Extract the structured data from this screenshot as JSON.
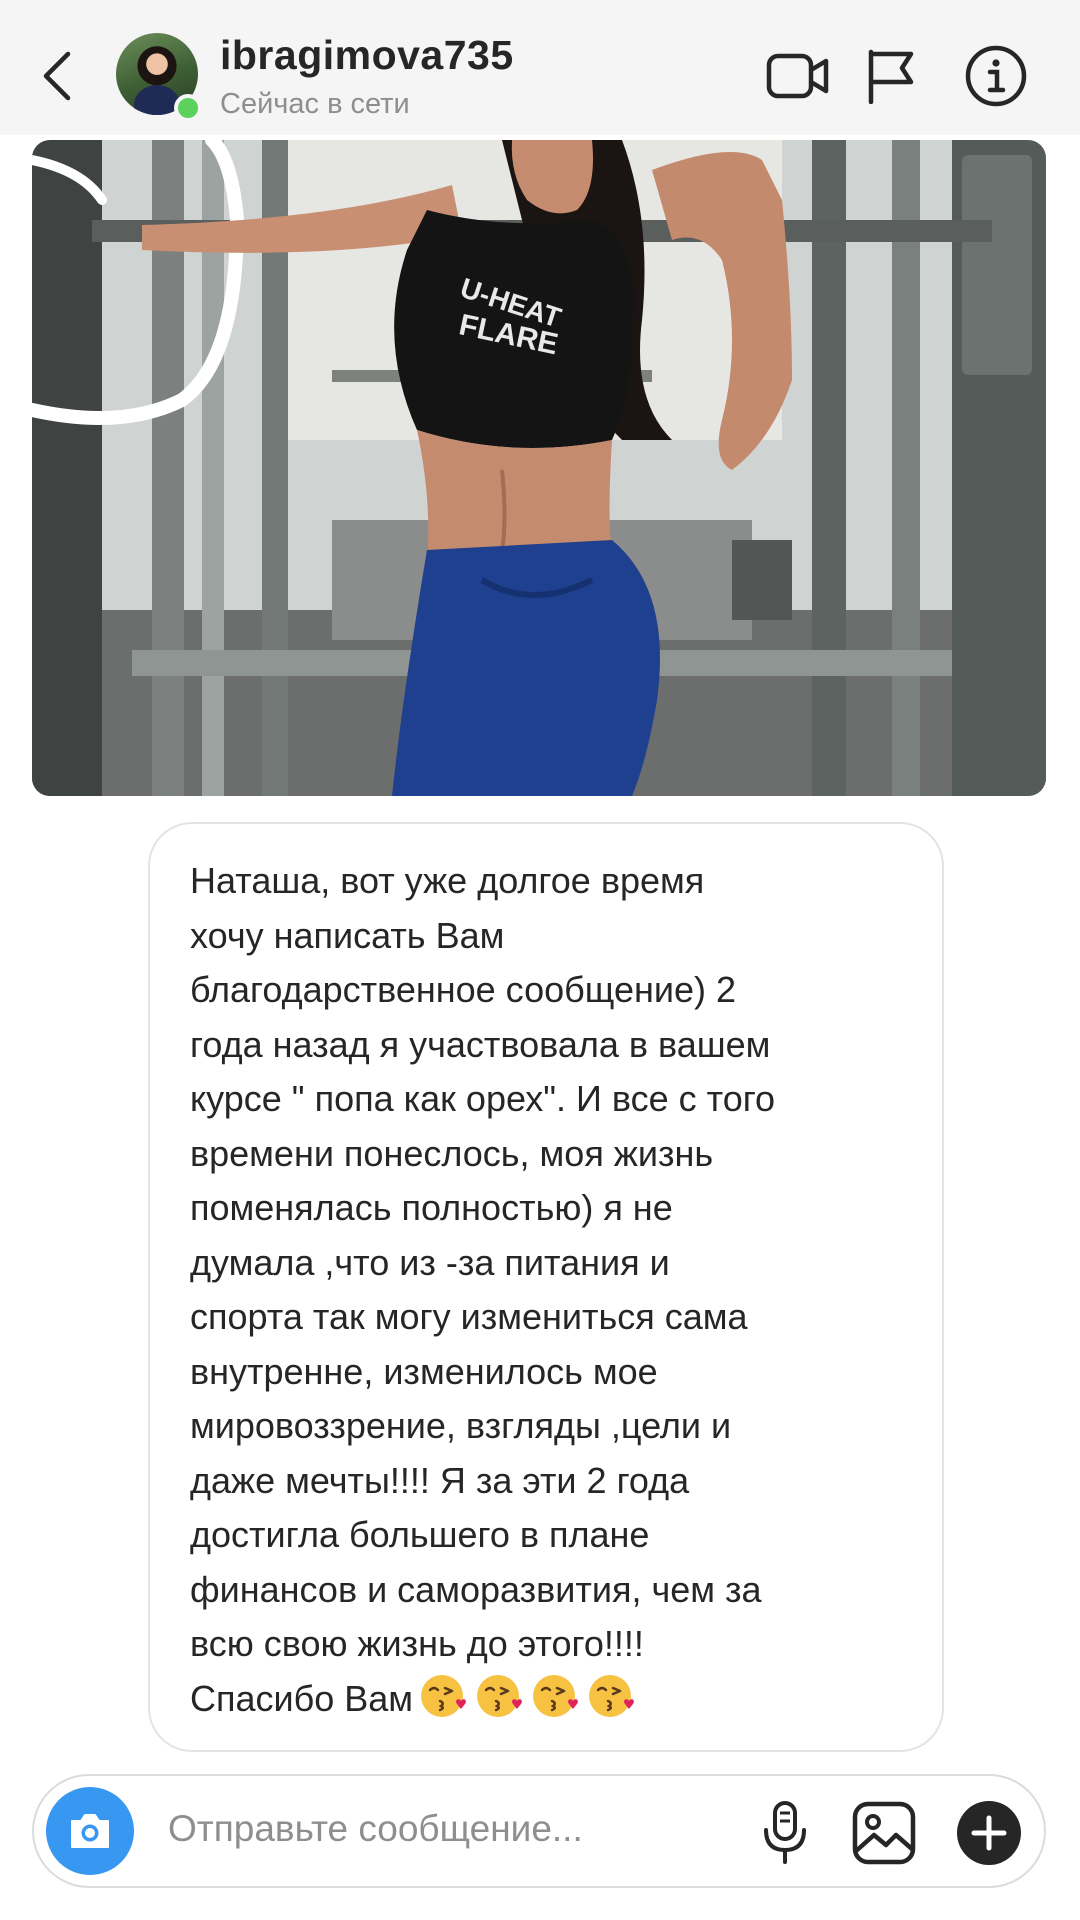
{
  "header": {
    "username": "ibragimova735",
    "status": "Сейчас в сети",
    "icons": [
      "back-icon",
      "video-call-icon",
      "flag-icon",
      "info-icon"
    ]
  },
  "photo": {
    "shirt_text_1": "U-HEAT",
    "shirt_text_2": "FLARE"
  },
  "message": {
    "text": "Наташа, вот уже долгое время\nхочу написать Вам\nблагодарственное сообщение) 2\nгода назад я участвовала в вашем\nкурсе \" попа как орех\". И все с того\nвремени понеслось, моя жизнь\nпоменялась полностью) я не\nдумала ,что из -за питания и\nспорта так могу измениться сама\nвнутренне, изменилось мое\nмировоззрение, взгляды ,цели и\nдаже мечты!!!! Я за эти 2 года\nдостигла большего в плане\nфинансов и  саморазвития, чем за\nвсю свою жизнь до этого!!!!\nСпасибо Вам",
    "emoji_count": 4,
    "emoji_name": "kissing-face-emoji"
  },
  "composer": {
    "placeholder": "Отправьте сообщение...",
    "icons": [
      "camera-icon",
      "microphone-icon",
      "gallery-icon",
      "plus-icon"
    ]
  },
  "colors": {
    "header_bg": "#f5f5f5",
    "online": "#5cd15c",
    "camera_button": "#3897f0",
    "secondary_text": "#8e8e8e"
  }
}
